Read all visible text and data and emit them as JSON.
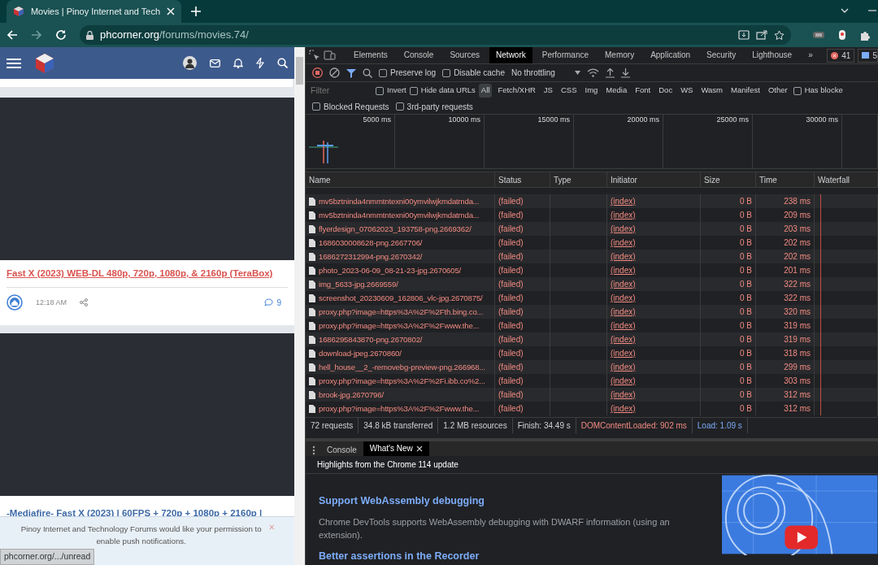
{
  "browser": {
    "tab": {
      "title": "Movies | Pinoy Internet and Tech"
    },
    "url": {
      "host": "phcorner.org",
      "path": "/forums/movies.74/"
    }
  },
  "page": {
    "posts": [
      {
        "title": "Fast X (2023) WEB-DL 480p, 720p, 1080p, & 2160p (TeraBox)",
        "time": "12:18 AM",
        "replies": "9"
      }
    ],
    "next_title": "-Mediafire- Fast X (2023) | 60FPS + 720p + 1080p + 2160p |",
    "notice": {
      "text": "Pinoy Internet and Technology Forums would like your permission to",
      "link": "enable push notifications."
    },
    "status_url": "phcorner.org/.../unread"
  },
  "devtools": {
    "tabs": [
      {
        "label": "Elements",
        "selected": false
      },
      {
        "label": "Console",
        "selected": false
      },
      {
        "label": "Sources",
        "selected": false
      },
      {
        "label": "Network",
        "selected": true
      },
      {
        "label": "Performance",
        "selected": false
      },
      {
        "label": "Memory",
        "selected": false
      },
      {
        "label": "Application",
        "selected": false
      },
      {
        "label": "Security",
        "selected": false
      },
      {
        "label": "Lighthouse",
        "selected": false
      }
    ],
    "more": "»",
    "errors": "41",
    "messages": "5",
    "toolbar": {
      "checks": [
        {
          "label": "Preserve log",
          "checked": false
        },
        {
          "label": "Disable cache",
          "checked": false
        }
      ],
      "throttling": "No throttling"
    },
    "filter": {
      "placeholder": "Filter",
      "checks": [
        {
          "label": "Invert",
          "checked": false
        },
        {
          "label": "Hide data URLs",
          "checked": false
        }
      ],
      "types": [
        {
          "label": "All",
          "selected": true
        },
        {
          "label": "Fetch/XHR",
          "selected": false
        },
        {
          "label": "JS",
          "selected": false
        },
        {
          "label": "CSS",
          "selected": false
        },
        {
          "label": "Img",
          "selected": false
        },
        {
          "label": "Media",
          "selected": false
        },
        {
          "label": "Font",
          "selected": false
        },
        {
          "label": "Doc",
          "selected": false
        },
        {
          "label": "WS",
          "selected": false
        },
        {
          "label": "Wasm",
          "selected": false
        },
        {
          "label": "Manifest",
          "selected": false
        },
        {
          "label": "Other",
          "selected": false
        }
      ],
      "has_blocked": {
        "label": "Has blocke",
        "checked": false
      },
      "more_checks": [
        {
          "label": "Blocked Requests",
          "checked": false
        },
        {
          "label": "3rd-party requests",
          "checked": false
        }
      ]
    },
    "overview_ticks": [
      "5000 ms",
      "10000 ms",
      "15000 ms",
      "20000 ms",
      "25000 ms",
      "30000 ms"
    ],
    "table": {
      "columns": [
        "Name",
        "Status",
        "Type",
        "Initiator",
        "Size",
        "Time",
        "Waterfall"
      ],
      "rows": [
        {
          "name": "mv5bztninda4nmmtntexni00ymvilwjkmdatmda...",
          "status": "(failed)",
          "initiator": "(index)",
          "size": "0 B",
          "time": "238 ms"
        },
        {
          "name": "mv5bztninda4nmmtntexni00ymvilwjkmdatmda...",
          "status": "(failed)",
          "initiator": "(index)",
          "size": "0 B",
          "time": "209 ms"
        },
        {
          "name": "flyerdesign_07062023_193758-png.2669362/",
          "status": "(failed)",
          "initiator": "(index)",
          "size": "0 B",
          "time": "203 ms"
        },
        {
          "name": "1686030008628-png.2667706/",
          "status": "(failed)",
          "initiator": "(index)",
          "size": "0 B",
          "time": "202 ms"
        },
        {
          "name": "1686272312994-png.2670342/",
          "status": "(failed)",
          "initiator": "(index)",
          "size": "0 B",
          "time": "202 ms"
        },
        {
          "name": "photo_2023-06-09_08-21-23-jpg.2670605/",
          "status": "(failed)",
          "initiator": "(index)",
          "size": "0 B",
          "time": "201 ms"
        },
        {
          "name": "img_5633-jpg.2669559/",
          "status": "(failed)",
          "initiator": "(index)",
          "size": "0 B",
          "time": "322 ms"
        },
        {
          "name": "screenshot_20230609_162806_vlc-jpg.2670875/",
          "status": "(failed)",
          "initiator": "(index)",
          "size": "0 B",
          "time": "322 ms"
        },
        {
          "name": "proxy.php?image=https%3A%2F%2Fth.bing.co...",
          "status": "(failed)",
          "initiator": "(index)",
          "size": "0 B",
          "time": "320 ms"
        },
        {
          "name": "proxy.php?image=https%3A%2F%2Fwww.the...",
          "status": "(failed)",
          "initiator": "(index)",
          "size": "0 B",
          "time": "319 ms"
        },
        {
          "name": "1686295843870-png.2670802/",
          "status": "(failed)",
          "initiator": "(index)",
          "size": "0 B",
          "time": "319 ms"
        },
        {
          "name": "download-jpeg.2670860/",
          "status": "(failed)",
          "initiator": "(index)",
          "size": "0 B",
          "time": "318 ms"
        },
        {
          "name": "hell_house__2_-removebg-preview-png.266968...",
          "status": "(failed)",
          "initiator": "(index)",
          "size": "0 B",
          "time": "299 ms"
        },
        {
          "name": "proxy.php?image=https%3A%2F%2Fi.ibb.co%2...",
          "status": "(failed)",
          "initiator": "(index)",
          "size": "0 B",
          "time": "303 ms"
        },
        {
          "name": "brook-jpg.2670796/",
          "status": "(failed)",
          "initiator": "(index)",
          "size": "0 B",
          "time": "312 ms"
        },
        {
          "name": "proxy.php?image=https%3A%2F%2Fwww.the...",
          "status": "(failed)",
          "initiator": "(index)",
          "size": "0 B",
          "time": "312 ms"
        }
      ]
    },
    "status_bar": [
      {
        "kind": "plain",
        "text": "72 requests"
      },
      {
        "kind": "plain",
        "text": "34.8 kB transferred"
      },
      {
        "kind": "plain",
        "text": "1.2 MB resources"
      },
      {
        "kind": "plain",
        "text": "Finish: 34.49 s"
      },
      {
        "kind": "dom",
        "text": "DOMContentLoaded: 902 ms"
      },
      {
        "kind": "load",
        "text": "Load: 1.09 s"
      }
    ],
    "drawer": {
      "tabs": [
        {
          "label": "Console",
          "selected": false
        },
        {
          "label": "What's New",
          "selected": true
        }
      ],
      "heading": "Highlights from the Chrome 114 update",
      "items": [
        {
          "title": "Support WebAssembly debugging",
          "text": "Chrome DevTools supports WebAssembly debugging with DWARF information (using an extension)."
        },
        {
          "title": "Better assertions in the Recorder"
        }
      ]
    }
  }
}
